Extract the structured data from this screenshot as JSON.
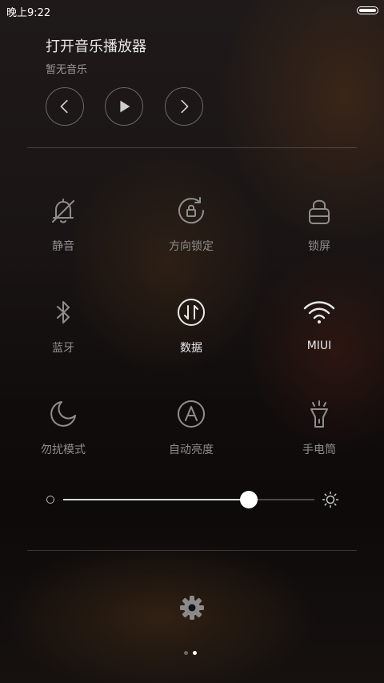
{
  "status_bar": {
    "time": "晚上9:22"
  },
  "music": {
    "title": "打开音乐播放器",
    "subtitle": "暂无音乐",
    "controls": {
      "previous_icon": "chevron-left-icon",
      "play_icon": "play-icon",
      "next_icon": "chevron-right-icon"
    }
  },
  "toggles": [
    {
      "label": "静音",
      "icon": "bell-off-icon",
      "active": false
    },
    {
      "label": "方向锁定",
      "icon": "rotation-lock-icon",
      "active": false
    },
    {
      "label": "锁屏",
      "icon": "lock-icon",
      "active": false
    },
    {
      "label": "蓝牙",
      "icon": "bluetooth-icon",
      "active": false
    },
    {
      "label": "数据",
      "icon": "mobile-data-icon",
      "active": true
    },
    {
      "label": "MIUI",
      "icon": "wifi-icon",
      "active": true
    },
    {
      "label": "勿扰模式",
      "icon": "moon-icon",
      "active": false
    },
    {
      "label": "自动亮度",
      "icon": "auto-brightness-icon",
      "active": false
    },
    {
      "label": "手电筒",
      "icon": "flashlight-icon",
      "active": false
    }
  ],
  "brightness": {
    "level_percent": 74
  },
  "page_indicator": {
    "total": 2,
    "current": 2
  },
  "colors": {
    "active": "#e9e9e9",
    "inactive": "#8e8e8e",
    "dot_active": "#ffffff",
    "dot_inactive": "#6a6a6a"
  }
}
